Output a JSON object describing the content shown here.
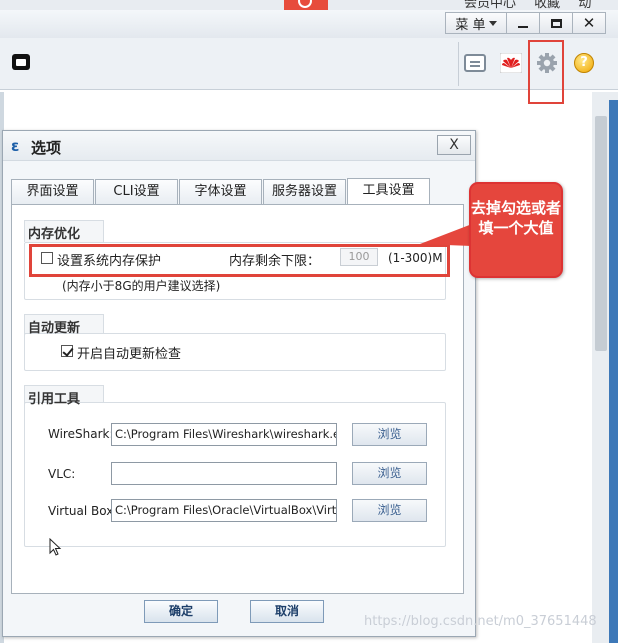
{
  "app": {
    "top_text": [
      "会员中心",
      "收藏",
      "动"
    ],
    "menu_label": "菜 单",
    "close_glyph": "✕",
    "help_glyph": "?"
  },
  "dialog": {
    "title": "选项",
    "close_glyph": "X",
    "tabs": [
      {
        "label": "界面设置",
        "active": false
      },
      {
        "label": "CLI设置",
        "active": false
      },
      {
        "label": "字体设置",
        "active": false
      },
      {
        "label": "服务器设置",
        "active": false
      },
      {
        "label": "工具设置",
        "active": true
      }
    ],
    "memory": {
      "group_title": "内存优化",
      "protect_label": "设置系统内存保护",
      "protect_checked": false,
      "lower_limit_label": "内存剩余下限：",
      "lower_limit_value": "100",
      "range_label": "(1-300)M",
      "hint": "(内存小于8G的用户建议选择)"
    },
    "auto_update": {
      "group_title": "自动更新",
      "check_label": "开启自动更新检查",
      "checked": true
    },
    "tools": {
      "group_title": "引用工具",
      "rows": [
        {
          "label": "WireShark:",
          "value": "C:\\Program Files\\Wireshark\\wireshark.exe",
          "button": "浏览"
        },
        {
          "label": "VLC:",
          "value": "",
          "button": "浏览"
        },
        {
          "label": "Virtual Box:",
          "value": "C:\\Program Files\\Oracle\\VirtualBox\\VirtualBox",
          "button": "浏览"
        }
      ]
    },
    "ok_label": "确定",
    "cancel_label": "取消"
  },
  "annotation": {
    "text": "去掉勾选或者填一个大值",
    "color": "#e5463d"
  },
  "watermark": "https://blog.csdn.net/m0_37651448"
}
